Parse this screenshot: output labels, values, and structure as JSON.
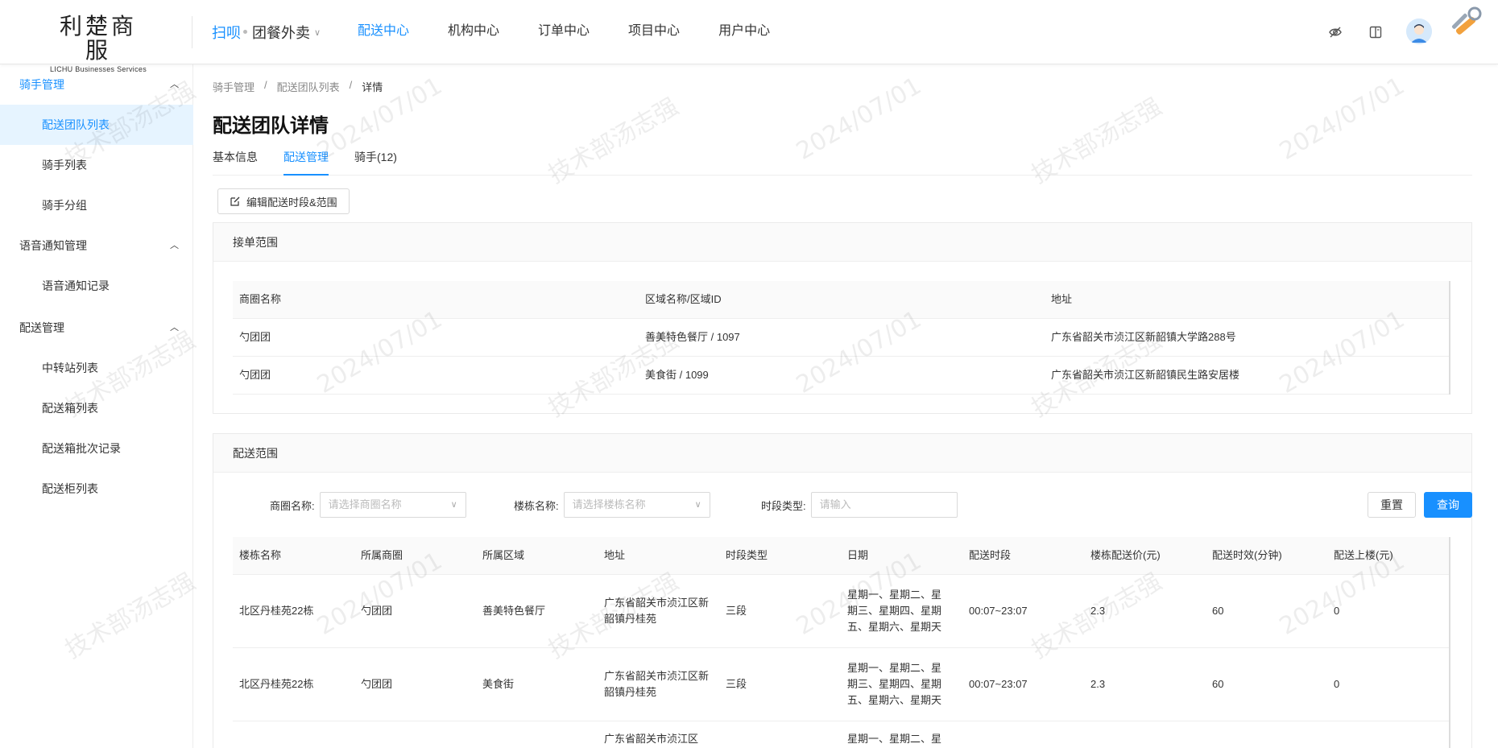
{
  "header": {
    "logo_main": "利楚商服",
    "logo_sub": "LICHU Businesses Services",
    "brand": "扫呗",
    "business": "团餐外卖",
    "nav": [
      "配送中心",
      "机构中心",
      "订单中心",
      "项目中心",
      "用户中心"
    ],
    "active_nav": "配送中心"
  },
  "sidebar": {
    "groups": [
      {
        "title": "骑手管理",
        "open": true,
        "items": [
          "配送团队列表",
          "骑手列表",
          "骑手分组"
        ]
      },
      {
        "title": "语音通知管理",
        "open": false,
        "items": [
          "语音通知记录"
        ]
      },
      {
        "title": "配送管理",
        "open": false,
        "items": [
          "中转站列表",
          "配送箱列表",
          "配送箱批次记录",
          "配送柜列表"
        ]
      }
    ],
    "active_item": "配送团队列表"
  },
  "breadcrumb": [
    "骑手管理",
    "配送团队列表",
    "详情"
  ],
  "page_title": "配送团队详情",
  "tabs": [
    "基本信息",
    "配送管理",
    "骑手(12)"
  ],
  "active_tab": "配送管理",
  "edit_button": "编辑配送时段&范围",
  "order_scope": {
    "title": "接单范围",
    "columns": [
      "商圈名称",
      "区域名称/区域ID",
      "地址"
    ],
    "rows": [
      [
        "勺团团",
        "善美特色餐厅 / 1097",
        "广东省韶关市浈江区新韶镇大学路288号"
      ],
      [
        "勺团团",
        "美食街 / 1099",
        "广东省韶关市浈江区新韶镇民生路安居楼"
      ]
    ]
  },
  "delivery_scope": {
    "title": "配送范围",
    "filters": {
      "circle_label": "商圈名称:",
      "circle_placeholder": "请选择商圈名称",
      "building_label": "楼栋名称:",
      "building_placeholder": "请选择楼栋名称",
      "period_label": "时段类型:",
      "period_placeholder": "请输入"
    },
    "reset_label": "重置",
    "query_label": "查询",
    "columns": [
      "楼栋名称",
      "所属商圈",
      "所属区域",
      "地址",
      "时段类型",
      "日期",
      "配送时段",
      "楼栋配送价(元)",
      "配送时效(分钟)",
      "配送上楼(元)"
    ],
    "rows": [
      [
        "北区丹桂苑22栋",
        "勺团团",
        "善美特色餐厅",
        "广东省韶关市浈江区新韶镇丹桂苑",
        "三段",
        "星期一、星期二、星期三、星期四、星期五、星期六、星期天",
        "00:07~23:07",
        "2.3",
        "60",
        "0"
      ],
      [
        "北区丹桂苑22栋",
        "勺团团",
        "美食街",
        "广东省韶关市浈江区新韶镇丹桂苑",
        "三段",
        "星期一、星期二、星期三、星期四、星期五、星期六、星期天",
        "00:07~23:07",
        "2.3",
        "60",
        "0"
      ],
      [
        "",
        "",
        "",
        "广东省韶关市浈江区",
        "",
        "星期一、星期二、星",
        "",
        "",
        "",
        ""
      ]
    ]
  },
  "watermark": {
    "name": "技术部汤志强",
    "date": "2024/07/01"
  }
}
